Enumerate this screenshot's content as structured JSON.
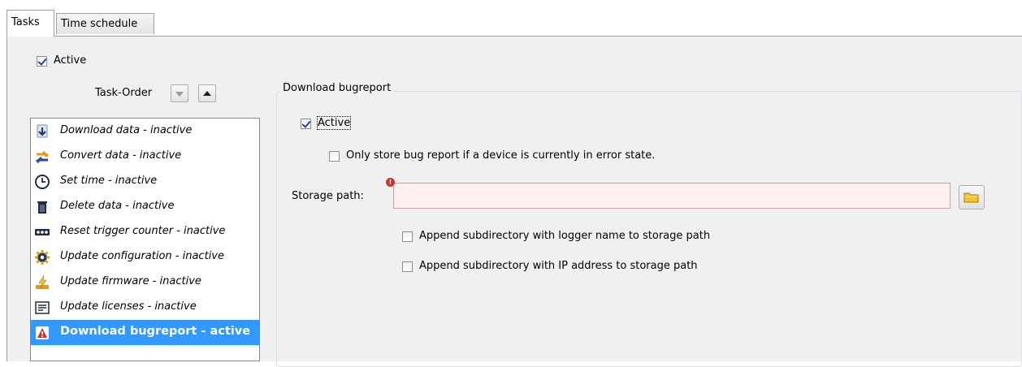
{
  "tabs": [
    {
      "label": "Tasks",
      "active": true
    },
    {
      "label": "Time schedule",
      "active": false
    }
  ],
  "global_active": {
    "label": "Active",
    "checked": true
  },
  "task_order": {
    "label": "Task-Order"
  },
  "tasks": [
    {
      "label": "Download data - inactive",
      "icon": "download-arrow-icon",
      "selected": false
    },
    {
      "label": "Convert data - inactive",
      "icon": "convert-arrows-icon",
      "selected": false
    },
    {
      "label": "Set time - inactive",
      "icon": "clock-icon",
      "selected": false
    },
    {
      "label": "Delete data - inactive",
      "icon": "trash-icon",
      "selected": false
    },
    {
      "label": "Reset trigger counter - inactive",
      "icon": "counter-icon",
      "selected": false
    },
    {
      "label": "Update configuration - inactive",
      "icon": "gear-icon",
      "selected": false
    },
    {
      "label": "Update firmware - inactive",
      "icon": "firmware-bolt-icon",
      "selected": false
    },
    {
      "label": "Update licenses - inactive",
      "icon": "license-icon",
      "selected": false
    },
    {
      "label": "Download bugreport - active",
      "icon": "bugreport-icon",
      "selected": true
    }
  ],
  "detail": {
    "title": "Download bugreport",
    "active": {
      "label": "Active",
      "checked": true
    },
    "only_error": {
      "label": "Only store bug report if a device is currently in error state.",
      "checked": false
    },
    "storage_path": {
      "label": "Storage path:",
      "value": "",
      "error": true
    },
    "append_logger": {
      "label": "Append subdirectory with logger name to storage path",
      "checked": false
    },
    "append_ip": {
      "label": "Append subdirectory with IP address to storage path",
      "checked": false
    }
  },
  "colors": {
    "selection": "#3399ff",
    "panel_bg": "#f0f0f0",
    "error_field_bg": "#fff0f0",
    "error_dot": "#d92b2b"
  }
}
